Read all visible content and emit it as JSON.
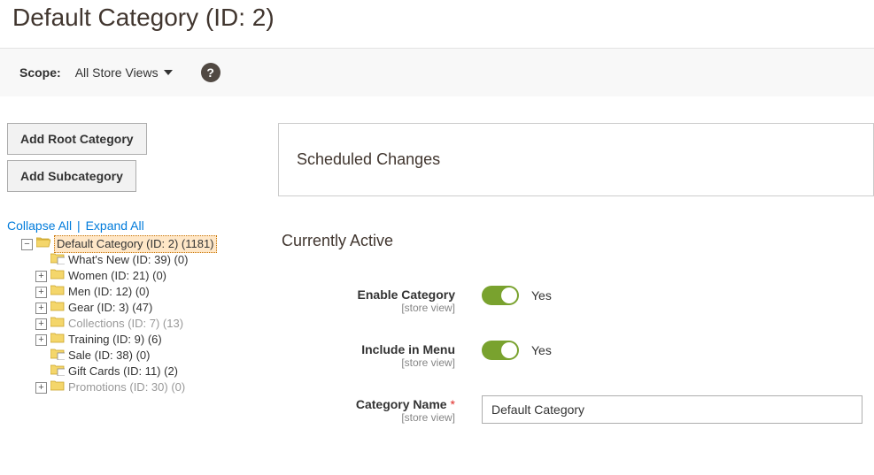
{
  "page_title": "Default Category (ID: 2)",
  "scope": {
    "label": "Scope:",
    "value": "All Store Views"
  },
  "sidebar": {
    "add_root": "Add Root Category",
    "add_sub": "Add Subcategory",
    "collapse": "Collapse All",
    "expand": "Expand All"
  },
  "tree": [
    {
      "indent": 16,
      "toggle": "−",
      "icon": "open",
      "label": "Default Category (ID: 2) (1181)",
      "state": "selected"
    },
    {
      "indent": 32,
      "toggle": "",
      "icon": "leaf",
      "label": "What's New (ID: 39) (0)"
    },
    {
      "indent": 32,
      "toggle": "+",
      "icon": "closed",
      "label": "Women (ID: 21) (0)"
    },
    {
      "indent": 32,
      "toggle": "+",
      "icon": "closed",
      "label": "Men (ID: 12) (0)"
    },
    {
      "indent": 32,
      "toggle": "+",
      "icon": "closed",
      "label": "Gear (ID: 3) (47)"
    },
    {
      "indent": 32,
      "toggle": "+",
      "icon": "closed",
      "label": "Collections (ID: 7) (13)",
      "state": "disabled"
    },
    {
      "indent": 32,
      "toggle": "+",
      "icon": "closed",
      "label": "Training (ID: 9) (6)"
    },
    {
      "indent": 32,
      "toggle": "",
      "icon": "leaf",
      "label": "Sale (ID: 38) (0)"
    },
    {
      "indent": 32,
      "toggle": "",
      "icon": "leaf",
      "label": "Gift Cards (ID: 11) (2)"
    },
    {
      "indent": 32,
      "toggle": "+",
      "icon": "closed",
      "label": "Promotions (ID: 30) (0)",
      "state": "disabled"
    }
  ],
  "panel": {
    "scheduled_changes": "Scheduled Changes"
  },
  "section": {
    "currently_active": "Currently Active"
  },
  "fields": {
    "enable_category": {
      "label": "Enable Category",
      "scope": "[store view]",
      "value": "Yes",
      "on": true
    },
    "include_in_menu": {
      "label": "Include in Menu",
      "scope": "[store view]",
      "value": "Yes",
      "on": true
    },
    "category_name": {
      "label": "Category Name",
      "scope": "[store view]",
      "value": "Default Category",
      "required": true
    }
  }
}
